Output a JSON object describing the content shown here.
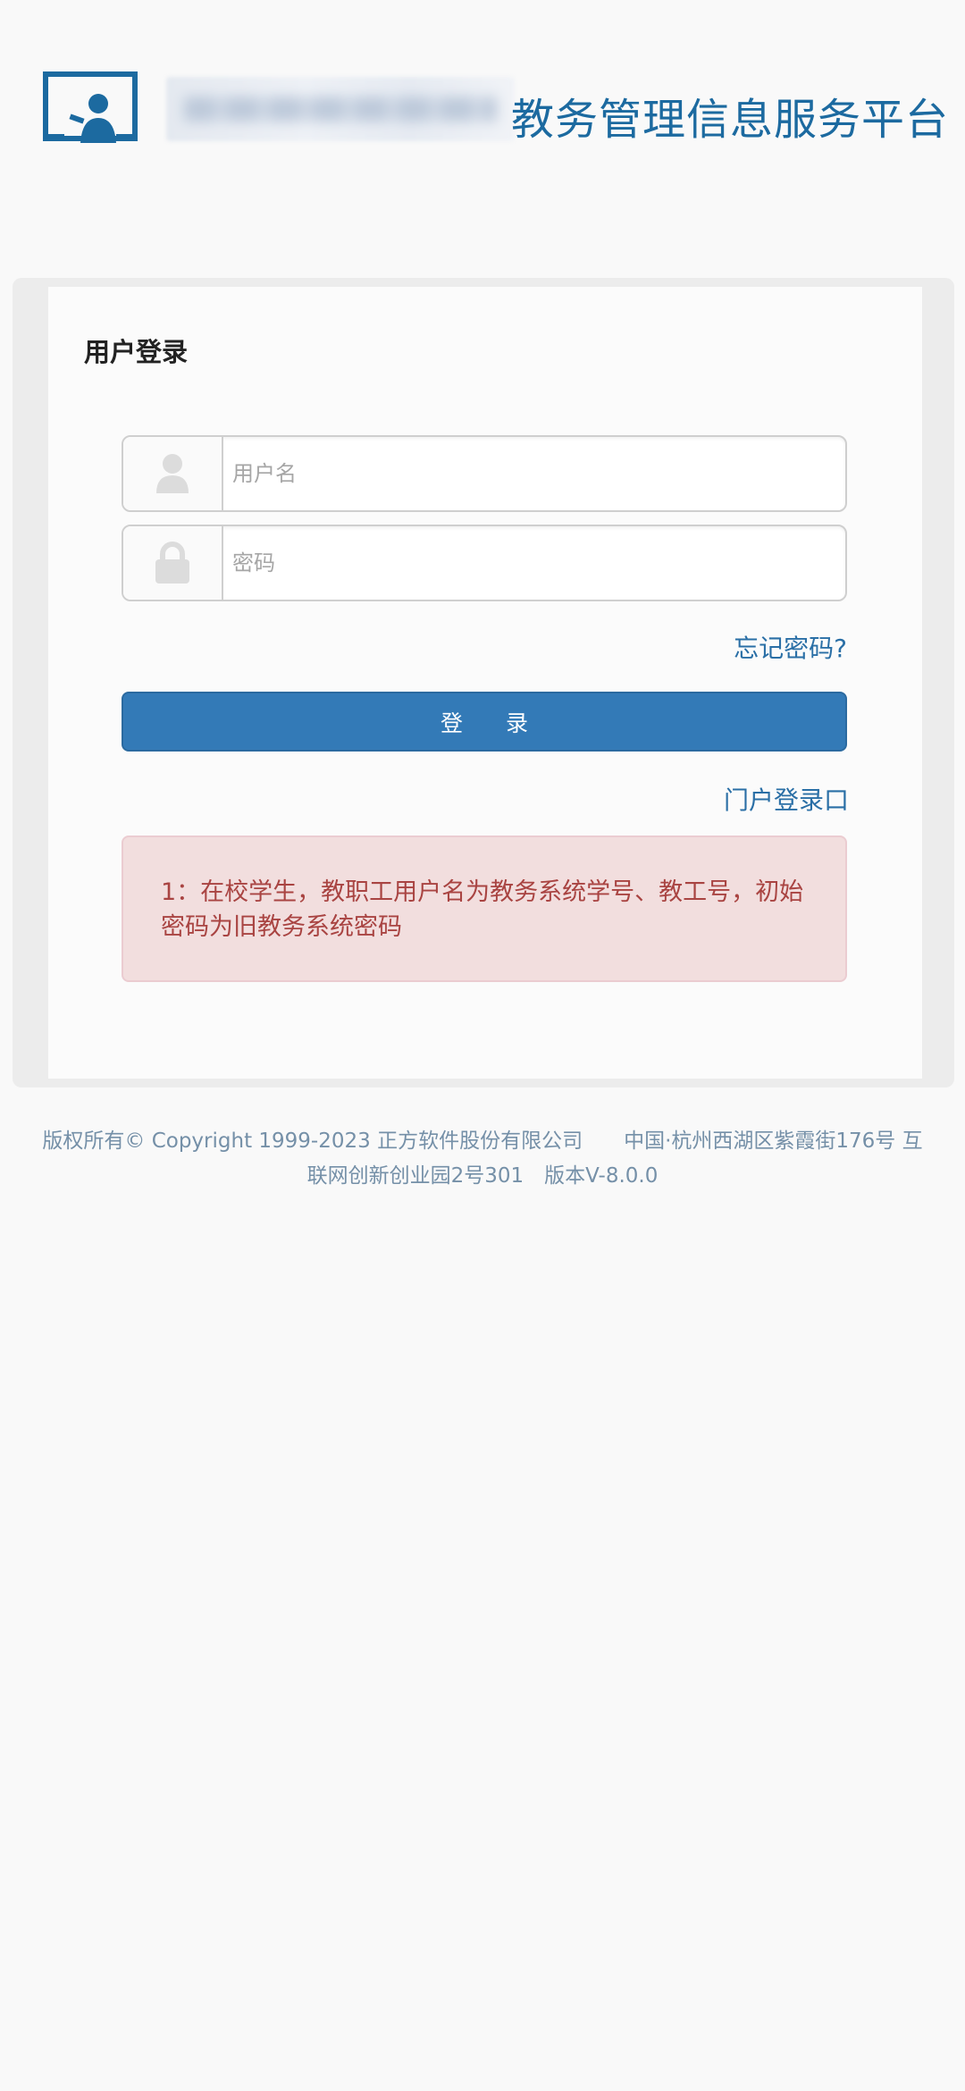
{
  "header": {
    "title": "教务管理信息服务平台"
  },
  "login": {
    "heading": "用户登录",
    "username_placeholder": "用户名",
    "password_placeholder": "密码",
    "forgot_password": "忘记密码?",
    "login_button": "登 录",
    "portal_login": "门户登录口",
    "notice": "1：在校学生，教职工用户名为教务系统学号、教工号，初始密码为旧教务系统密码"
  },
  "footer": {
    "line1": "版权所有© Copyright 1999-2023 正方软件股份有限公司　　中国·杭州西湖区紫霞街176号 互",
    "line2": "联网创新创业园2号301　版本V-8.0.0"
  },
  "colors": {
    "brand": "#1c6aa0",
    "button": "#337ab7",
    "alert_bg": "#f2dede",
    "alert_text": "#a94442"
  },
  "icons": {
    "logo": "presentation-user-icon",
    "username": "user-icon",
    "password": "lock-icon"
  }
}
